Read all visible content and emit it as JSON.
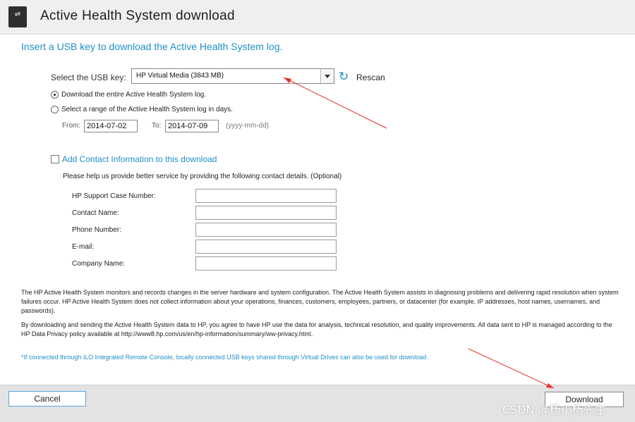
{
  "header": {
    "title": "Active Health System download",
    "icon": "usb-icon"
  },
  "instruction": "Insert a USB key to download the Active Health System log.",
  "usb": {
    "label": "Select the USB key:",
    "selected": "HP Virtual Media (3843 MB)",
    "rescan_label": "Rescan"
  },
  "download_options": {
    "entire": "Download the entire Active Health System log.",
    "range": "Select a range of the Active Health System log in days.",
    "selected": "entire",
    "from_label": "From:",
    "from_value": "2014-07-02",
    "to_label": "To:",
    "to_value": "2014-07-09",
    "format_hint": "(yyyy-mm-dd)"
  },
  "contact": {
    "checkbox_label": "Add Contact Information to this download",
    "checked": false,
    "help": "Please help us provide better service by providing the following contact details. (Optional)",
    "fields": [
      {
        "label": "HP Support Case Number:",
        "value": ""
      },
      {
        "label": "Contact Name:",
        "value": ""
      },
      {
        "label": "Phone Number:",
        "value": ""
      },
      {
        "label": "E-mail:",
        "value": ""
      },
      {
        "label": "Company Name:",
        "value": ""
      }
    ]
  },
  "disclaimer": {
    "p1": "The HP Active Health System monitors and records changes in the server hardware and system configuration. The Active Health System assists in diagnosing problems and delivering rapid resolution when system failures occur. HP Active Health System does not collect information about your operations, finances, customers, employees, partners, or datacenter (for example, IP addresses, host names, usernames, and passwords).",
    "p2": "By downloading and sending the Active Health System data to HP, you agree to have HP use the data for analysis, technical resolution, and quality improvements. All data sent to HP is managed according to the HP Data Privacy policy available at http://www8.hp.com/us/en/hp-information/summary/ww-privacy.html.",
    "note": "*If connected through iLO Integrated Remote Console, locally connected USB keys shared through Virtual Drives can also be used for download."
  },
  "footer": {
    "cancel_label": "Cancel",
    "download_label": "Download"
  },
  "watermark": "CSDN @杨小杨先生",
  "colors": {
    "accent": "#1f8fc8",
    "annotation": "#e8302a"
  }
}
